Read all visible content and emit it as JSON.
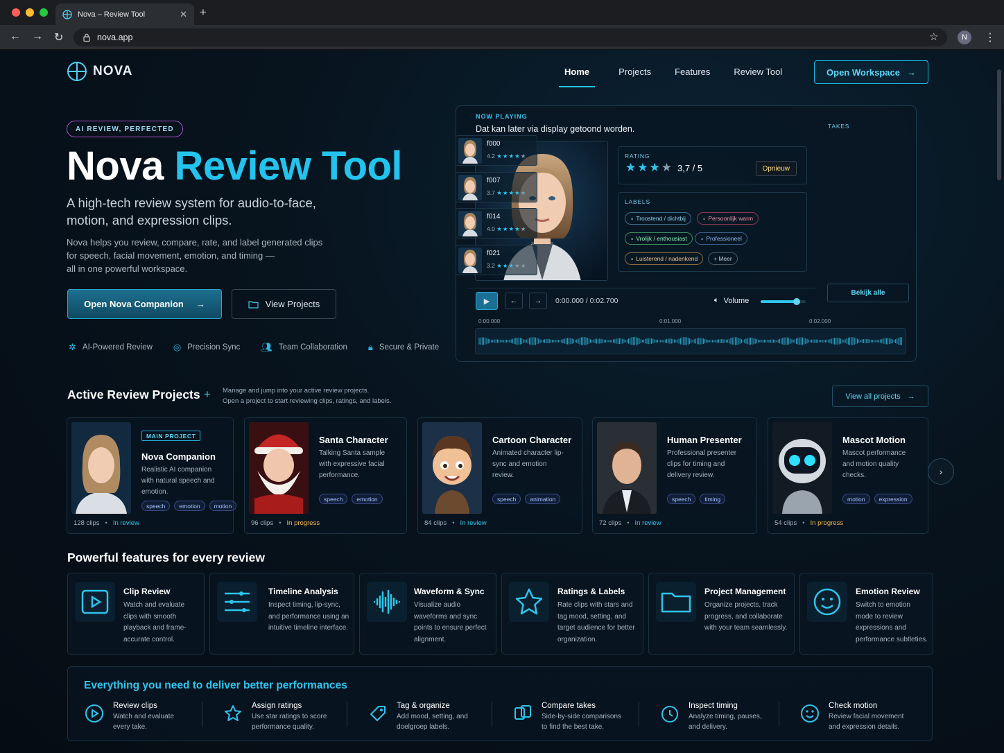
{
  "browser": {
    "tab_title": "Nova – Review Tool",
    "url": "nova.app",
    "profile_initial": "N"
  },
  "nav": {
    "logo": "NOVA",
    "items": [
      "Home",
      "Projects",
      "Features",
      "Review Tool"
    ],
    "cta": "Open Workspace"
  },
  "hero": {
    "badge": "AI REVIEW, PERFECTED",
    "title_a": "Nova",
    "title_b": "Review Tool",
    "subtitle": "A high-tech review system for audio-to-face, motion, and expression clips.",
    "desc_1": "Nova helps you review, compare, rate, and label generated clips",
    "desc_2": "for speech, facial movement, emotion, and timing —",
    "desc_3": "all in one powerful workspace.",
    "primary_btn": "Open Nova Companion",
    "secondary_btn": "View Projects",
    "features": [
      "AI-Powered Review",
      "Precision Sync",
      "Team Collaboration",
      "Secure & Private"
    ]
  },
  "player": {
    "now_playing_label": "NOW PLAYING",
    "title": "Dat kan later via display getoond worden.",
    "rating_label": "RATING",
    "rating_value": "3,7 / 5",
    "rating_stars": 3.7,
    "retry": "Opnieuw",
    "labels_label": "LABELS",
    "labels": [
      "Troostend / dichtbij",
      "Persoonlijk warm",
      "Vrolijk / enthousiast",
      "Professioneel",
      "Luisterend / nadenkend",
      "+ Meer"
    ],
    "time": "0:00.000 / 0:02.700",
    "volume_label": "Volume",
    "volume_level": 0.8,
    "ticks": [
      "0:00.000",
      "0:01.000",
      "0:02.000"
    ],
    "takes_label": "TAKES",
    "takes": [
      {
        "name": "f000",
        "score": "4.2"
      },
      {
        "name": "f007",
        "score": "3.7"
      },
      {
        "name": "f014",
        "score": "4.0"
      },
      {
        "name": "f021",
        "score": "3.2"
      }
    ],
    "view_all": "Bekijk alle"
  },
  "projects": {
    "heading": "Active Review Projects",
    "note_1": "Manage and jump into your active review projects.",
    "note_2": "Open a project to start reviewing clips, ratings, and labels.",
    "view_all": "View all projects",
    "main_badge": "MAIN PROJECT",
    "items": [
      {
        "title": "Nova Companion",
        "desc": "Realistic AI companion with natural speech and emotion.",
        "tags": [
          "speech",
          "emotion",
          "motion"
        ],
        "clips": "128 clips",
        "status": "In review"
      },
      {
        "title": "Santa Character",
        "desc": "Talking Santa sample with expressive facial performance.",
        "tags": [
          "speech",
          "emotion"
        ],
        "clips": "96 clips",
        "status": "In progress"
      },
      {
        "title": "Cartoon Character",
        "desc": "Animated character lip-sync and emotion review.",
        "tags": [
          "speech",
          "animation"
        ],
        "clips": "84 clips",
        "status": "In review"
      },
      {
        "title": "Human Presenter",
        "desc": "Professional presenter clips for timing and delivery review.",
        "tags": [
          "speech",
          "timing"
        ],
        "clips": "72 clips",
        "status": "In review"
      },
      {
        "title": "Mascot Motion",
        "desc": "Mascot performance and motion quality checks.",
        "tags": [
          "motion",
          "expression"
        ],
        "clips": "54 clips",
        "status": "In progress"
      }
    ]
  },
  "features": {
    "heading": "Powerful features for every review",
    "items": [
      {
        "title": "Clip Review",
        "desc": "Watch and evaluate clips with smooth playback and frame-accurate control.",
        "icon": "play-icon"
      },
      {
        "title": "Timeline Analysis",
        "desc": "Inspect timing, lip-sync, and performance using an intuitive timeline interface.",
        "icon": "sliders-icon"
      },
      {
        "title": "Waveform & Sync",
        "desc": "Visualize audio waveforms and sync points to ensure perfect alignment.",
        "icon": "waveform-icon"
      },
      {
        "title": "Ratings & Labels",
        "desc": "Rate clips with stars and tag mood, setting, and target audience for better organization.",
        "icon": "star-icon"
      },
      {
        "title": "Project Management",
        "desc": "Organize projects, track progress, and collaborate with your team seamlessly.",
        "icon": "folder-icon"
      },
      {
        "title": "Emotion Review",
        "desc": "Switch to emotion mode to review expressions and performance subtleties.",
        "icon": "smile-icon"
      }
    ]
  },
  "bottom": {
    "heading": "Everything you need to deliver better performances",
    "items": [
      {
        "title": "Review clips",
        "desc_1": "Watch and evaluate",
        "desc_2": "every take."
      },
      {
        "title": "Assign ratings",
        "desc_1": "Use star ratings to score",
        "desc_2": "performance quality."
      },
      {
        "title": "Tag & organize",
        "desc_1": "Add mood, setting, and",
        "desc_2": "doelgroep labels."
      },
      {
        "title": "Compare takes",
        "desc_1": "Side-by-side comparisons",
        "desc_2": "to find the best take."
      },
      {
        "title": "Inspect timing",
        "desc_1": "Analyze timing, pauses,",
        "desc_2": "and delivery."
      },
      {
        "title": "Check motion",
        "desc_1": "Review facial movement",
        "desc_2": "and expression details."
      }
    ]
  },
  "colors": {
    "accent": "#22c4ee",
    "status_review": "#2ec5ee",
    "status_progress": "#f2b84b"
  }
}
